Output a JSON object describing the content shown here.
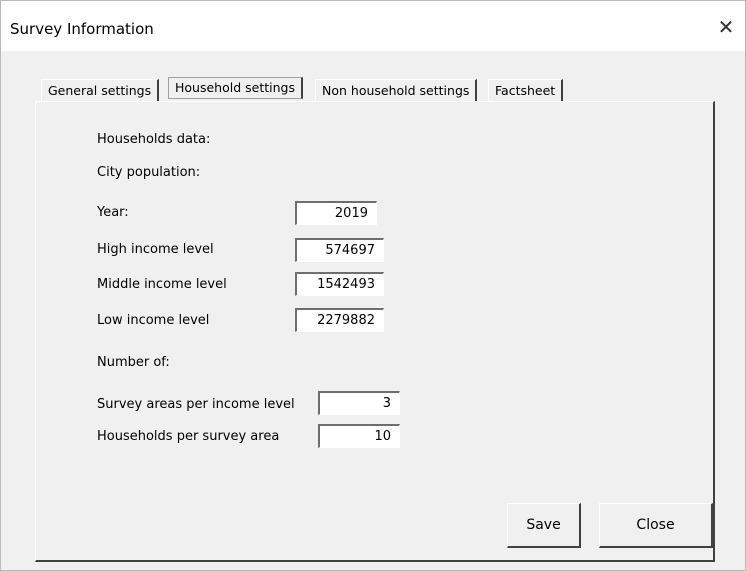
{
  "window": {
    "title": "Survey Information",
    "close_glyph": "✕"
  },
  "tabs": [
    {
      "label": "General settings",
      "active": false
    },
    {
      "label": "Household settings",
      "active": true
    },
    {
      "label": "Non household settings",
      "active": false
    },
    {
      "label": "Factsheet",
      "active": false
    }
  ],
  "household": {
    "households_data_label": "Households data:",
    "city_population_label": "City population:",
    "rows": [
      {
        "label": "Year:",
        "value": "2019"
      },
      {
        "label": "High income level",
        "value": "574697"
      },
      {
        "label": "Middle income level",
        "value": "1542493"
      },
      {
        "label": "Low income level",
        "value": "2279882"
      }
    ],
    "number_of_label": "Number of:",
    "survey": [
      {
        "label": "Survey areas per income level",
        "value": "3"
      },
      {
        "label": "Households per survey area",
        "value": "10"
      }
    ]
  },
  "buttons": {
    "save": "Save",
    "close": "Close"
  }
}
